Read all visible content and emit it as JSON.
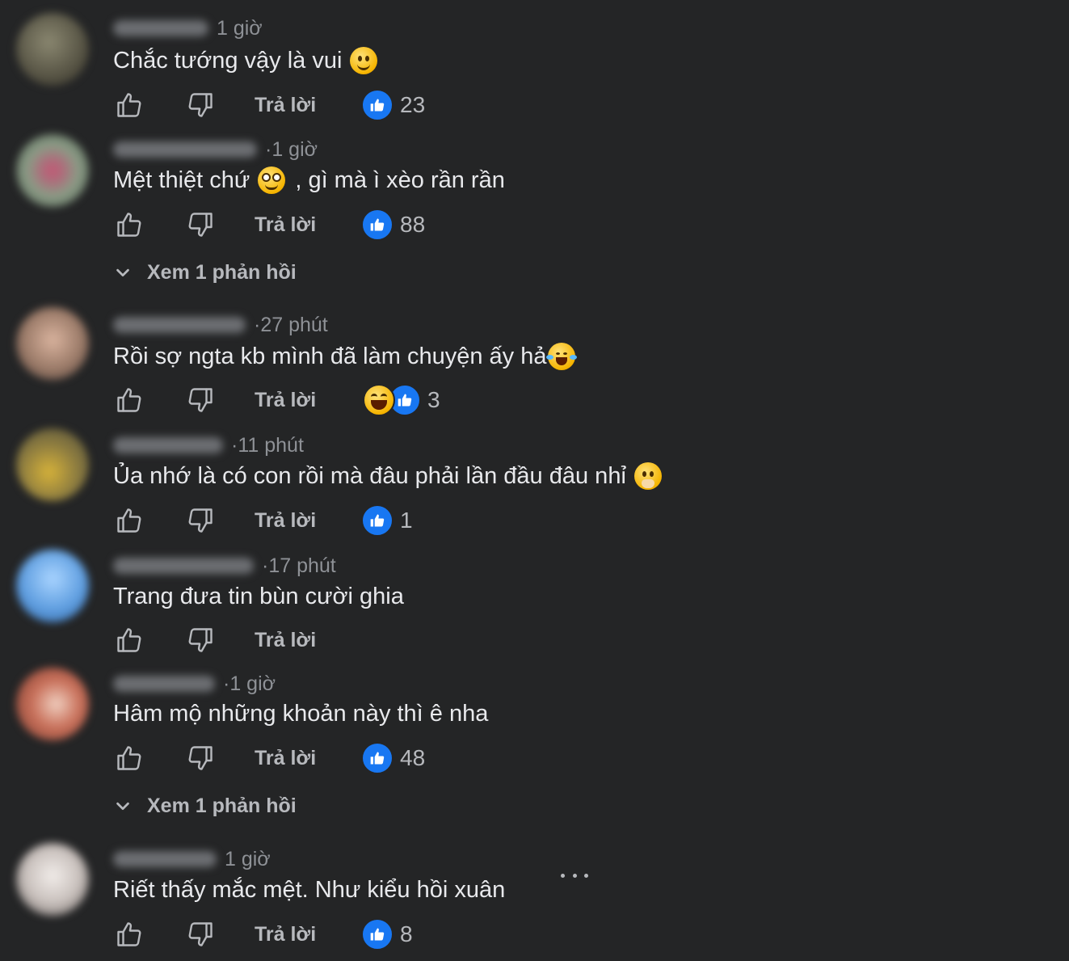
{
  "comments": [
    {
      "time": "1 giờ",
      "time_prefix": "",
      "text": "Chắc tướng vậy là vui",
      "emoji": "smiling-face",
      "reply_label": "Trả lời",
      "reaction_count": "23",
      "reactions": [
        "like"
      ],
      "avatar_color": "#6d6a55"
    },
    {
      "time": "1 giờ",
      "time_prefix": "· ",
      "text": "Mệt thiệt chứ",
      "text_after_emoji": ", gì mà ì xèo rần rần",
      "emoji": "pleading-face",
      "reply_label": "Trả lời",
      "reaction_count": "88",
      "reactions": [
        "like"
      ],
      "avatar_color": "#9a6b6e"
    },
    {
      "time": "27 phút",
      "time_prefix": "· ",
      "text": "Rồi sợ ngta kb mình đã làm chuyện ấy hả",
      "emoji": "tears-of-joy-face",
      "reply_label": "Trả lời",
      "reaction_count": "3",
      "reactions": [
        "haha",
        "like"
      ],
      "avatar_color": "#8a7268"
    },
    {
      "time": "11 phút",
      "time_prefix": "· ",
      "text": "Ủa nhớ là có con rồi mà đâu phải lần đầu đâu nhỉ",
      "emoji": "face-with-hand-over-mouth",
      "reply_label": "Trả lời",
      "reaction_count": "1",
      "reactions": [
        "like"
      ],
      "avatar_color": "#7d7a4a"
    },
    {
      "time": "17 phút",
      "time_prefix": "· ",
      "text": "Trang đưa tin bùn cười ghia",
      "emoji": "",
      "reply_label": "Trả lời",
      "reaction_count": "",
      "reactions": [],
      "avatar_color": "#5f9ee0"
    },
    {
      "time": "1 giờ",
      "time_prefix": "· ",
      "text": "Hâm mộ những khoản này thì ê nha",
      "emoji": "",
      "reply_label": "Trả lời",
      "reaction_count": "48",
      "reactions": [
        "like"
      ],
      "avatar_color": "#b0705a"
    },
    {
      "time": "1 giờ",
      "time_prefix": "",
      "text": "Riết thấy mắc mệt. Như kiểu hồi xuân",
      "emoji": "",
      "reply_label": "Trả lời",
      "reaction_count": "8",
      "reactions": [
        "like"
      ],
      "avatar_color": "#c9c1bd"
    }
  ],
  "view_replies": [
    {
      "label": "Xem 1 phản hồi"
    },
    {
      "label": "Xem 1 phản hồi"
    }
  ],
  "icons": {
    "like": "thumbs-up-outline-icon",
    "dislike": "thumbs-down-outline-icon",
    "reaction_like": "like-reaction-icon",
    "reaction_haha": "haha-reaction-icon",
    "chevron": "chevron-down-icon",
    "more": "more-options-icon"
  },
  "colors": {
    "background": "#242526",
    "text": "#e8e9ec",
    "muted": "#b7b9bd",
    "accent": "#1877f2"
  }
}
